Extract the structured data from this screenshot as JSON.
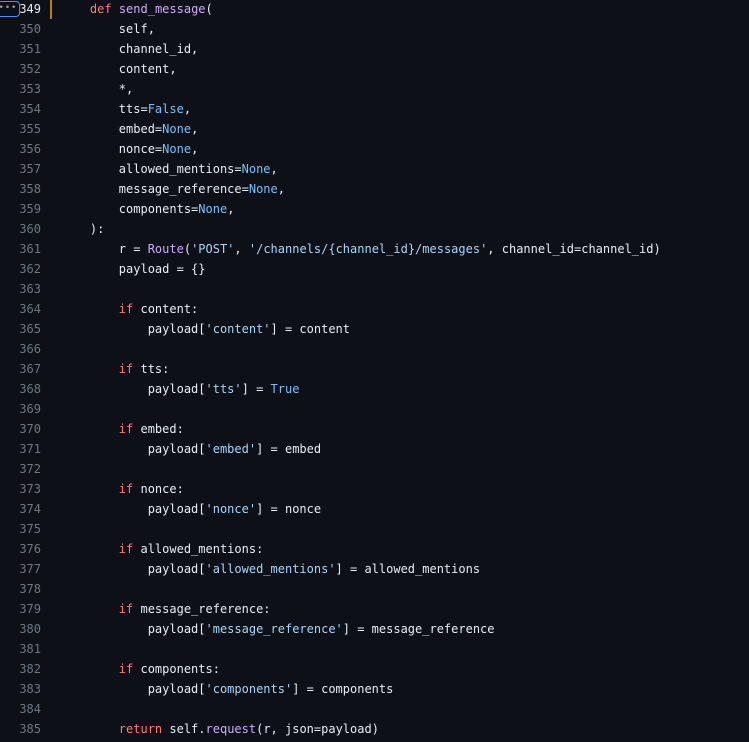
{
  "editor": {
    "expander_label": "•••",
    "active_line": 0
  },
  "colors": {
    "keyword": "#ff7b72",
    "function": "#d2a8ff",
    "constant": "#79c0ff",
    "string": "#a5d6ff",
    "text": "#e6edf3",
    "line_number": "#6e7681",
    "highlight_bar": "#bb8009",
    "background": "#0d1117"
  },
  "lines": [
    {
      "n": "349",
      "tokens": [
        [
          "t",
          "    "
        ],
        [
          "k",
          "def"
        ],
        [
          "t",
          " "
        ],
        [
          "f",
          "send_message"
        ],
        [
          "t",
          "("
        ]
      ]
    },
    {
      "n": "350",
      "tokens": [
        [
          "t",
          "        self,"
        ]
      ]
    },
    {
      "n": "351",
      "tokens": [
        [
          "t",
          "        channel_id,"
        ]
      ]
    },
    {
      "n": "352",
      "tokens": [
        [
          "t",
          "        content,"
        ]
      ]
    },
    {
      "n": "353",
      "tokens": [
        [
          "t",
          "        *,"
        ]
      ]
    },
    {
      "n": "354",
      "tokens": [
        [
          "t",
          "        tts="
        ],
        [
          "c",
          "False"
        ],
        [
          "t",
          ","
        ]
      ]
    },
    {
      "n": "355",
      "tokens": [
        [
          "t",
          "        embed="
        ],
        [
          "c",
          "None"
        ],
        [
          "t",
          ","
        ]
      ]
    },
    {
      "n": "356",
      "tokens": [
        [
          "t",
          "        nonce="
        ],
        [
          "c",
          "None"
        ],
        [
          "t",
          ","
        ]
      ]
    },
    {
      "n": "357",
      "tokens": [
        [
          "t",
          "        allowed_mentions="
        ],
        [
          "c",
          "None"
        ],
        [
          "t",
          ","
        ]
      ]
    },
    {
      "n": "358",
      "tokens": [
        [
          "t",
          "        message_reference="
        ],
        [
          "c",
          "None"
        ],
        [
          "t",
          ","
        ]
      ]
    },
    {
      "n": "359",
      "tokens": [
        [
          "t",
          "        components="
        ],
        [
          "c",
          "None"
        ],
        [
          "t",
          ","
        ]
      ]
    },
    {
      "n": "360",
      "tokens": [
        [
          "t",
          "    ):"
        ]
      ]
    },
    {
      "n": "361",
      "tokens": [
        [
          "t",
          "        r = "
        ],
        [
          "f",
          "Route"
        ],
        [
          "t",
          "("
        ],
        [
          "s",
          "'POST'"
        ],
        [
          "t",
          ", "
        ],
        [
          "s",
          "'/channels/{channel_id}/messages'"
        ],
        [
          "t",
          ", channel_id=channel_id)"
        ]
      ]
    },
    {
      "n": "362",
      "tokens": [
        [
          "t",
          "        payload = {}"
        ]
      ]
    },
    {
      "n": "363",
      "tokens": []
    },
    {
      "n": "364",
      "tokens": [
        [
          "t",
          "        "
        ],
        [
          "k",
          "if"
        ],
        [
          "t",
          " content:"
        ]
      ]
    },
    {
      "n": "365",
      "tokens": [
        [
          "t",
          "            payload["
        ],
        [
          "s",
          "'content'"
        ],
        [
          "t",
          "] = content"
        ]
      ]
    },
    {
      "n": "366",
      "tokens": []
    },
    {
      "n": "367",
      "tokens": [
        [
          "t",
          "        "
        ],
        [
          "k",
          "if"
        ],
        [
          "t",
          " tts:"
        ]
      ]
    },
    {
      "n": "368",
      "tokens": [
        [
          "t",
          "            payload["
        ],
        [
          "s",
          "'tts'"
        ],
        [
          "t",
          "] = "
        ],
        [
          "c",
          "True"
        ]
      ]
    },
    {
      "n": "369",
      "tokens": []
    },
    {
      "n": "370",
      "tokens": [
        [
          "t",
          "        "
        ],
        [
          "k",
          "if"
        ],
        [
          "t",
          " embed:"
        ]
      ]
    },
    {
      "n": "371",
      "tokens": [
        [
          "t",
          "            payload["
        ],
        [
          "s",
          "'embed'"
        ],
        [
          "t",
          "] = embed"
        ]
      ]
    },
    {
      "n": "372",
      "tokens": []
    },
    {
      "n": "373",
      "tokens": [
        [
          "t",
          "        "
        ],
        [
          "k",
          "if"
        ],
        [
          "t",
          " nonce:"
        ]
      ]
    },
    {
      "n": "374",
      "tokens": [
        [
          "t",
          "            payload["
        ],
        [
          "s",
          "'nonce'"
        ],
        [
          "t",
          "] = nonce"
        ]
      ]
    },
    {
      "n": "375",
      "tokens": []
    },
    {
      "n": "376",
      "tokens": [
        [
          "t",
          "        "
        ],
        [
          "k",
          "if"
        ],
        [
          "t",
          " allowed_mentions:"
        ]
      ]
    },
    {
      "n": "377",
      "tokens": [
        [
          "t",
          "            payload["
        ],
        [
          "s",
          "'allowed_mentions'"
        ],
        [
          "t",
          "] = allowed_mentions"
        ]
      ]
    },
    {
      "n": "378",
      "tokens": []
    },
    {
      "n": "379",
      "tokens": [
        [
          "t",
          "        "
        ],
        [
          "k",
          "if"
        ],
        [
          "t",
          " message_reference:"
        ]
      ]
    },
    {
      "n": "380",
      "tokens": [
        [
          "t",
          "            payload["
        ],
        [
          "s",
          "'message_reference'"
        ],
        [
          "t",
          "] = message_reference"
        ]
      ]
    },
    {
      "n": "381",
      "tokens": []
    },
    {
      "n": "382",
      "tokens": [
        [
          "t",
          "        "
        ],
        [
          "k",
          "if"
        ],
        [
          "t",
          " components:"
        ]
      ]
    },
    {
      "n": "383",
      "tokens": [
        [
          "t",
          "            payload["
        ],
        [
          "s",
          "'components'"
        ],
        [
          "t",
          "] = components"
        ]
      ]
    },
    {
      "n": "384",
      "tokens": []
    },
    {
      "n": "385",
      "tokens": [
        [
          "t",
          "        "
        ],
        [
          "k",
          "return"
        ],
        [
          "t",
          " self."
        ],
        [
          "f",
          "request"
        ],
        [
          "t",
          "(r, json=payload)"
        ]
      ]
    }
  ]
}
